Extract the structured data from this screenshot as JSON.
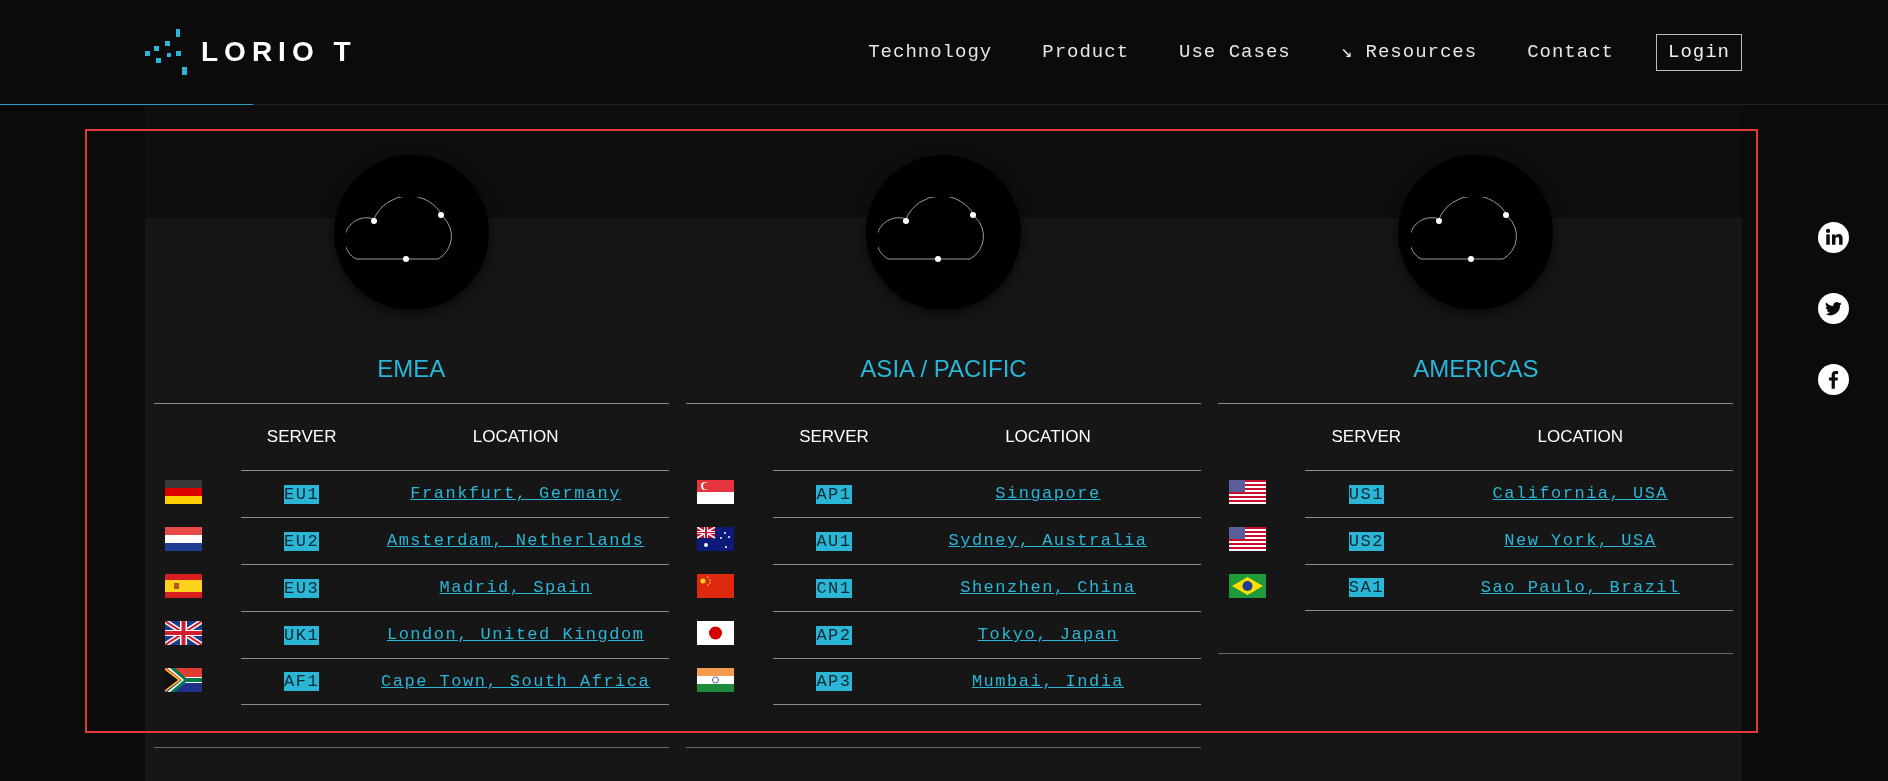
{
  "header": {
    "logo": "LORIO T",
    "nav": [
      "Technology",
      "Product",
      "Use Cases",
      "↘ Resources",
      "Contact"
    ],
    "login": "Login"
  },
  "regions": [
    {
      "title": "EMEA",
      "columns": [
        "SERVER",
        "LOCATION"
      ],
      "servers": [
        {
          "code": "EU1",
          "location": "Frankfurt, Germany"
        },
        {
          "code": "EU2",
          "location": "Amsterdam, Netherlands"
        },
        {
          "code": "EU3",
          "location": "Madrid, Spain"
        },
        {
          "code": "UK1",
          "location": "London, United Kingdom"
        },
        {
          "code": "AF1",
          "location": "Cape Town, South Africa"
        }
      ]
    },
    {
      "title": "ASIA / PACIFIC",
      "columns": [
        "SERVER",
        "LOCATION"
      ],
      "servers": [
        {
          "code": "AP1",
          "location": "Singapore"
        },
        {
          "code": "AU1",
          "location": "Sydney, Australia"
        },
        {
          "code": "CN1",
          "location": "Shenzhen, China"
        },
        {
          "code": "AP2",
          "location": "Tokyo, Japan"
        },
        {
          "code": "AP3",
          "location": "Mumbai, India"
        }
      ]
    },
    {
      "title": "AMERICAS",
      "columns": [
        "SERVER",
        "LOCATION"
      ],
      "servers": [
        {
          "code": "US1",
          "location": "California, USA"
        },
        {
          "code": "US2",
          "location": "New York, USA"
        },
        {
          "code": "SA1",
          "location": "Sao Paulo, Brazil"
        }
      ]
    }
  ]
}
